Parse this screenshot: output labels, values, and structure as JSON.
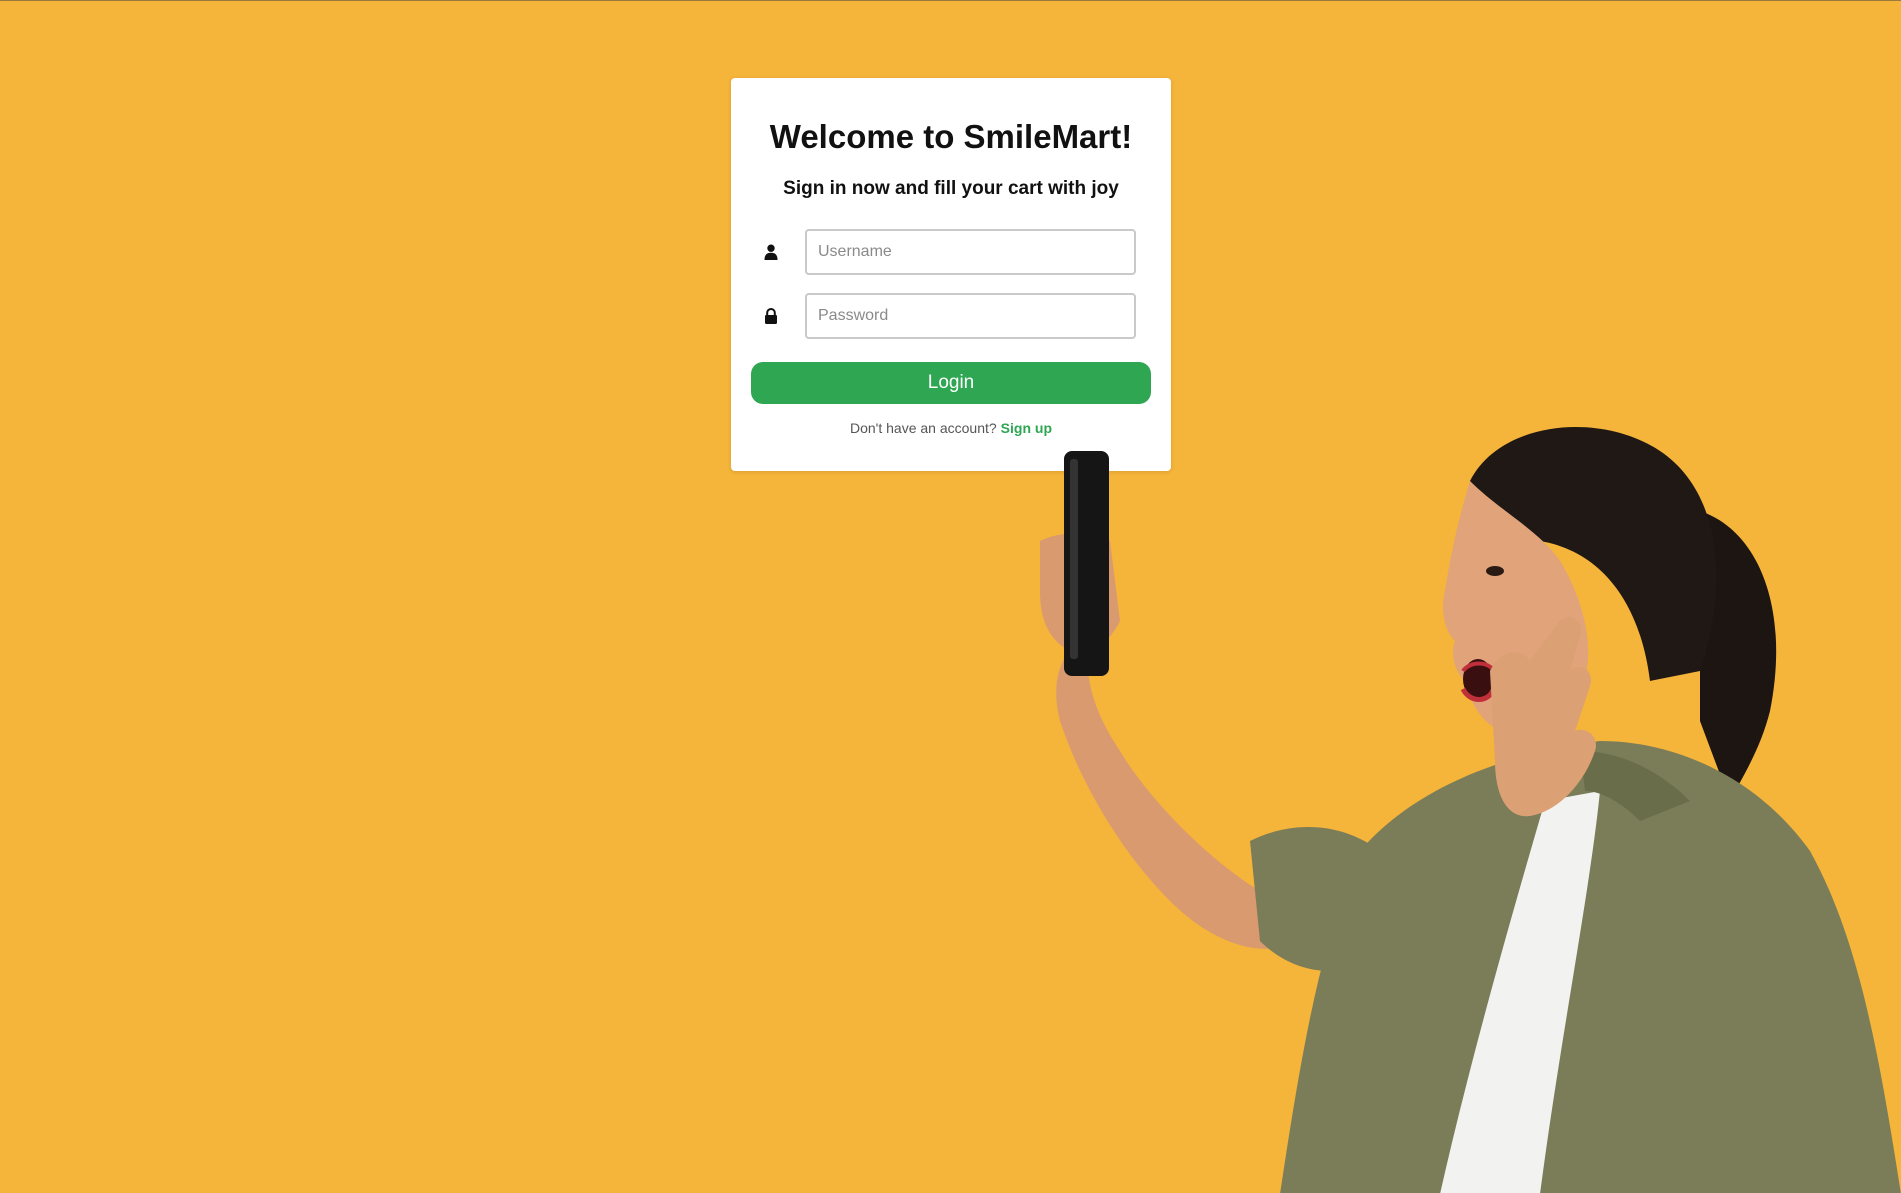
{
  "page": {
    "background_color": "#F5B43A",
    "accent_color": "#2EA652"
  },
  "login": {
    "title": "Welcome to SmileMart!",
    "subtitle": "Sign in now and fill your cart with joy",
    "username": {
      "icon": "user-icon",
      "placeholder": "Username",
      "value": ""
    },
    "password": {
      "icon": "lock-icon",
      "placeholder": "Password",
      "value": ""
    },
    "login_label": "Login",
    "signup_prompt": "Don't have an account?",
    "signup_link": "Sign up"
  },
  "hero": {
    "image": "woman-with-phone-surprised"
  }
}
